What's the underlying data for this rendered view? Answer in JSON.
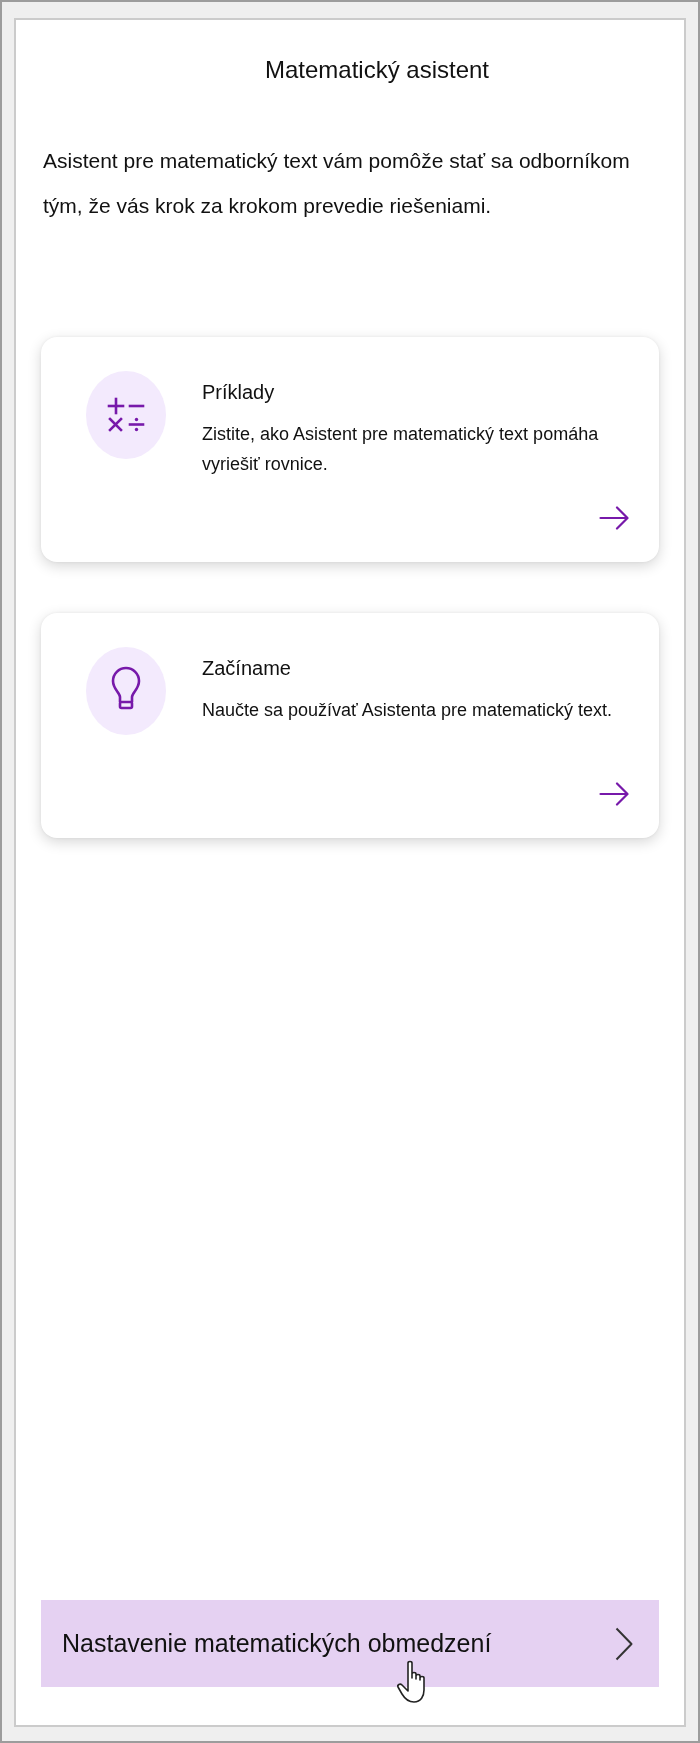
{
  "title": "Matematický asistent",
  "description": "Asistent pre matematický text vám pomôže stať sa odborníkom tým, že vás krok za krokom prevedie riešeniami.",
  "cards": [
    {
      "kind": "operators",
      "title": "Príklady",
      "description": "Zistite, ako Asistent pre matematický text pomáha vyriešiť rovnice."
    },
    {
      "kind": "lightbulb",
      "title": "Začíname",
      "description": "Naučte sa používať Asistenta pre matematický text."
    }
  ],
  "settings_button": {
    "label": "Nastavenie matematických obmedzení"
  }
}
